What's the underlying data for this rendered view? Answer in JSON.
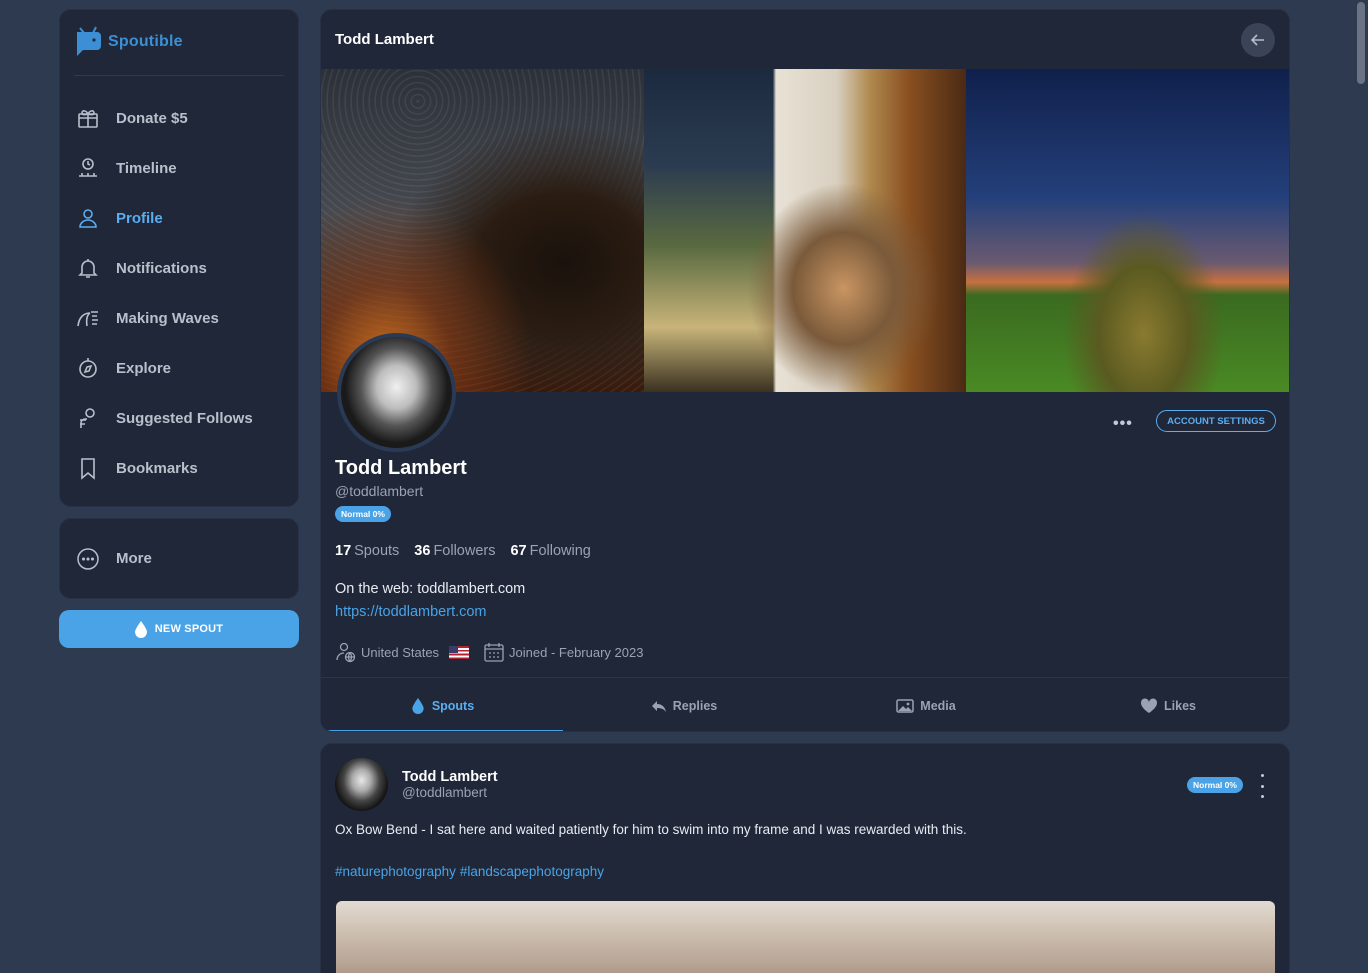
{
  "app": {
    "name": "Spoutible",
    "brand_color": "#3c8fd4",
    "accent_color": "#4aa3e6"
  },
  "sidebar": {
    "items": [
      {
        "label": "Donate $5",
        "icon": "gift-icon",
        "active": false
      },
      {
        "label": "Timeline",
        "icon": "timeline-icon",
        "active": false
      },
      {
        "label": "Profile",
        "icon": "user-icon",
        "active": true
      },
      {
        "label": "Notifications",
        "icon": "bell-icon",
        "active": false
      },
      {
        "label": "Making Waves",
        "icon": "wave-icon",
        "active": false
      },
      {
        "label": "Explore",
        "icon": "compass-icon",
        "active": false
      },
      {
        "label": "Suggested Follows",
        "icon": "user-search-icon",
        "active": false
      },
      {
        "label": "Bookmarks",
        "icon": "bookmark-icon",
        "active": false
      }
    ],
    "more_label": "More",
    "new_spout_label": "NEW SPOUT"
  },
  "header": {
    "title": "Todd Lambert"
  },
  "profile": {
    "name": "Todd Lambert",
    "handle": "@toddlambert",
    "badge": "Normal 0%",
    "account_settings_label": "ACCOUNT SETTINGS",
    "stats": [
      {
        "value": "17",
        "label": "Spouts"
      },
      {
        "value": "36",
        "label": "Followers"
      },
      {
        "value": "67",
        "label": "Following"
      }
    ],
    "bio": "On the web: toddlambert.com",
    "website": "https://toddlambert.com",
    "location": "United States",
    "joined": "Joined - February 2023"
  },
  "tabs": [
    {
      "label": "Spouts",
      "icon": "droplet-icon",
      "active": true
    },
    {
      "label": "Replies",
      "icon": "reply-icon",
      "active": false
    },
    {
      "label": "Media",
      "icon": "image-icon",
      "active": false
    },
    {
      "label": "Likes",
      "icon": "heart-icon",
      "active": false
    }
  ],
  "post": {
    "author_name": "Todd Lambert",
    "author_handle": "@toddlambert",
    "badge": "Normal 0%",
    "text": "Ox Bow Bend - I sat here and waited patiently for him to swim into my frame and I was rewarded with this.",
    "hashtags": [
      "#naturephotography",
      "#landscapephotography"
    ]
  }
}
